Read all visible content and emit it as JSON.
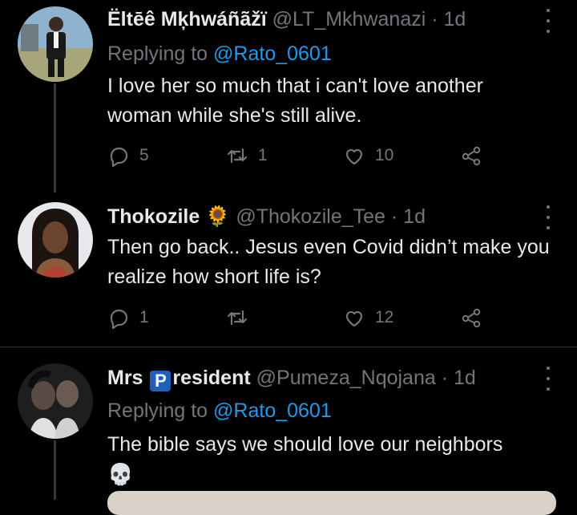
{
  "tweets": [
    {
      "name": "Ëltēê Mķhwáñãžï",
      "handle": "@LT_Mkhwanazi",
      "time": "1d",
      "replying_prefix": "Replying to",
      "replying_to": "@Rato_0601",
      "text": "I love her so much that i can't love another woman while she's still alive.",
      "replies": "5",
      "retweets": "1",
      "likes": "10"
    },
    {
      "name": "Thokozile",
      "name_emoji": "🌻",
      "handle": "@Thokozile_Tee",
      "time": "1d",
      "text": "Then go back.. Jesus even Covid didn’t make you realize how short life is?",
      "replies": "1",
      "retweets": "",
      "likes": "12"
    },
    {
      "name_before": "Mrs",
      "name_badge": "P",
      "name_after": "resident",
      "handle": "@Pumeza_Nqojana",
      "time": "1d",
      "replying_prefix": "Replying to",
      "replying_to": "@Rato_0601",
      "text": "The bible says we should love our neighbors",
      "emoji": "💀"
    }
  ],
  "separator_dot": "·",
  "icons": [
    "reply-icon",
    "retweet-icon",
    "like-icon",
    "share-icon",
    "more-icon"
  ],
  "colors": {
    "background": "#000000",
    "text": "#e7e9ea",
    "muted": "#71767b",
    "link": "#1d9bf0"
  }
}
